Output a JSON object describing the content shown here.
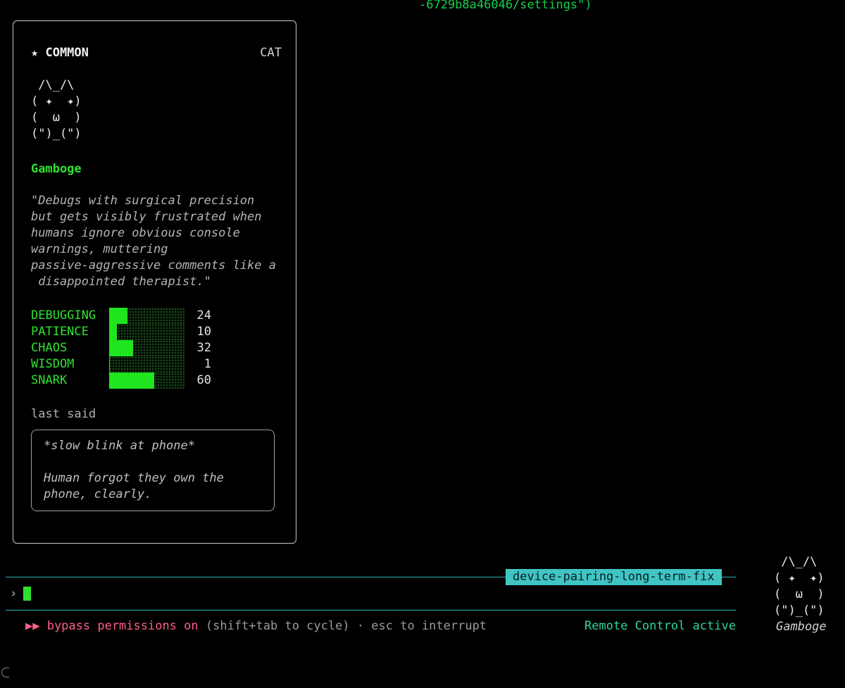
{
  "top_line": "-6729b8a46046/settings\")",
  "card": {
    "rarity": "★ COMMON",
    "type": "CAT",
    "ascii_art": " /\\_/\\\n( ✦  ✦)\n(  ω  )\n(\")_(\")",
    "name": "Gamboge",
    "quote": "\"Debugs with surgical precision\nbut gets visibly frustrated when\nhumans ignore obvious console\nwarnings, muttering\npassive-aggressive comments like a\n disappointed therapist.\"",
    "stats": [
      {
        "label": "DEBUGGING",
        "value": 24
      },
      {
        "label": "PATIENCE",
        "value": 10
      },
      {
        "label": "CHAOS",
        "value": 32
      },
      {
        "label": "WISDOM",
        "value": 1
      },
      {
        "label": "SNARK",
        "value": 60
      }
    ],
    "stats_max": 100,
    "last_said_label": "last said",
    "last_said": "*slow blink at phone*\n\nHuman forgot they own the\nphone, clearly."
  },
  "input": {
    "task_badge": "device-pairing-long-term-fix",
    "prompt": "›"
  },
  "status": {
    "bypass": "▶▶ bypass permissions on",
    "hint": " (shift+tab to cycle) · esc to interrupt",
    "remote": "Remote Control active"
  },
  "mini_cat": {
    "art": " /\\_/\\\n( ✦  ✦)\n(  ω  )\n(\")_(\")",
    "name": "Gamboge"
  },
  "colors": {
    "background": "#000000",
    "green": "#2ee22e",
    "bar_fill": "#1fe51f",
    "teal": "#2fb7bd",
    "badge_bg": "#41c4c4",
    "pink": "#ff5f87",
    "remote_green": "#2fd79a"
  }
}
